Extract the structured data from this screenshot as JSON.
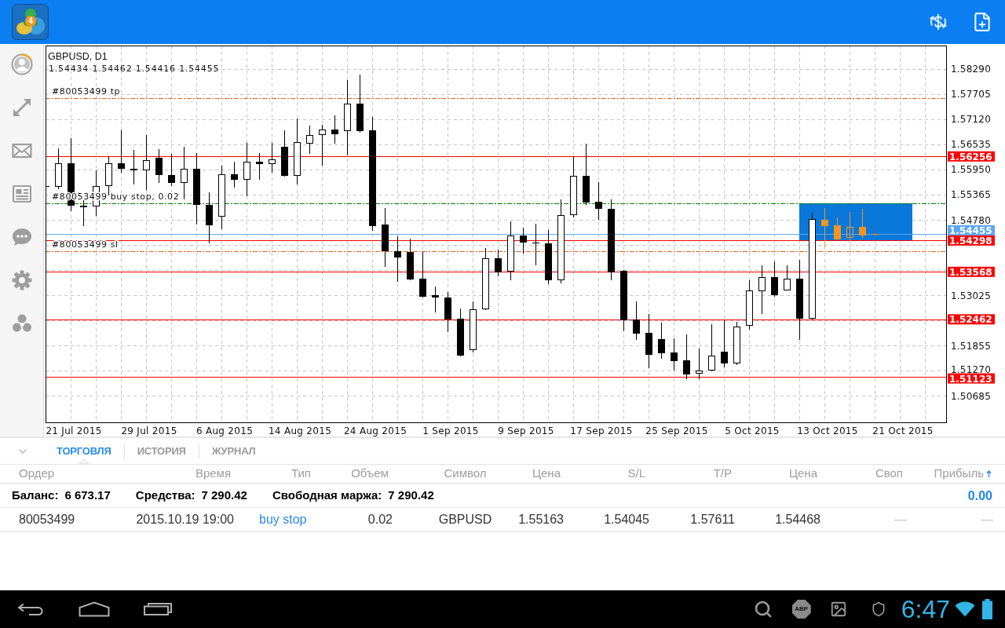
{
  "app_bar": {
    "logo_badge": "4"
  },
  "chart": {
    "chart_data": [
      {
        "type": "candlestick",
        "title": "GBPUSD, D1",
        "subtitle": "1.54434 1.54462 1.54416 1.54455",
        "categories": [
          null,
          null,
          "21 Jul 2015",
          null,
          null,
          null,
          null,
          null,
          "29 Jul 2015",
          null,
          null,
          null,
          null,
          null,
          "6 Aug 2015",
          null,
          null,
          null,
          null,
          null,
          "14 Aug 2015",
          null,
          null,
          null,
          null,
          null,
          "24 Aug 2015",
          null,
          null,
          null,
          null,
          null,
          "1 Sep 2015",
          null,
          null,
          null,
          null,
          null,
          "9 Sep 2015",
          null,
          null,
          null,
          null,
          null,
          "17 Sep 2015",
          null,
          null,
          null,
          null,
          null,
          "25 Sep 2015",
          null,
          null,
          null,
          null,
          null,
          "5 Oct 2015",
          null,
          null,
          null,
          null,
          null,
          "13 Oct 2015",
          null,
          null,
          null,
          null,
          null,
          "21 Oct 2015"
        ],
        "series": [
          {
            "type": "candlestick",
            "color": "#000000",
            "ohlc": [
              [
                1.5556,
                1.5556,
                1.5554,
                1.5554
              ],
              [
                1.5555,
                1.5644,
                1.5549,
                1.561
              ],
              [
                1.561,
                1.5668,
                1.5498,
                1.5511
              ],
              [
                1.5511,
                1.5524,
                1.5463,
                1.5507
              ],
              [
                1.5509,
                1.5593,
                1.5487,
                1.5557
              ],
              [
                1.5557,
                1.5626,
                1.5535,
                1.561
              ],
              [
                1.561,
                1.5686,
                1.5588,
                1.5597
              ],
              [
                1.5597,
                1.5641,
                1.556,
                1.5593
              ],
              [
                1.5593,
                1.5675,
                1.5548,
                1.5617
              ],
              [
                1.5622,
                1.5643,
                1.5564,
                1.5582
              ],
              [
                1.5582,
                1.5632,
                1.5557,
                1.5564
              ],
              [
                1.5564,
                1.5648,
                1.5526,
                1.5597
              ],
              [
                1.5597,
                1.5633,
                1.5467,
                1.5513
              ],
              [
                1.5513,
                1.5542,
                1.5423,
                1.5465
              ],
              [
                1.5485,
                1.5604,
                1.5456,
                1.5584
              ],
              [
                1.5584,
                1.5613,
                1.5553,
                1.5571
              ],
              [
                1.5571,
                1.5657,
                1.5533,
                1.5613
              ],
              [
                1.5613,
                1.5633,
                1.5571,
                1.5608
              ],
              [
                1.5608,
                1.5657,
                1.5588,
                1.5619
              ],
              [
                1.5648,
                1.5686,
                1.5579,
                1.558
              ],
              [
                1.558,
                1.5714,
                1.556,
                1.5659
              ],
              [
                1.5655,
                1.5697,
                1.5632,
                1.5675
              ],
              [
                1.5675,
                1.5699,
                1.5604,
                1.5688
              ],
              [
                1.5688,
                1.5721,
                1.5655,
                1.5677
              ],
              [
                1.5685,
                1.5803,
                1.5628,
                1.5749
              ],
              [
                1.5749,
                1.5816,
                1.5681,
                1.5685
              ],
              [
                1.5686,
                1.5718,
                1.5452,
                1.5463
              ],
              [
                1.5467,
                1.5505,
                1.5368,
                1.5405
              ],
              [
                1.5405,
                1.544,
                1.5334,
                1.539
              ],
              [
                1.5403,
                1.5434,
                1.5337,
                1.5339
              ],
              [
                1.5341,
                1.5405,
                1.5297,
                1.5299
              ],
              [
                1.5303,
                1.5323,
                1.5262,
                1.5297
              ],
              [
                1.5297,
                1.531,
                1.5217,
                1.5246
              ],
              [
                1.5248,
                1.5272,
                1.516,
                1.5162
              ],
              [
                1.5175,
                1.5288,
                1.5169,
                1.527
              ],
              [
                1.527,
                1.5412,
                1.5268,
                1.5389
              ],
              [
                1.5389,
                1.5409,
                1.5346,
                1.5356
              ],
              [
                1.5357,
                1.5474,
                1.5337,
                1.5441
              ],
              [
                1.5441,
                1.546,
                1.5399,
                1.5425
              ],
              [
                1.5425,
                1.5469,
                1.5372,
                1.5423
              ],
              [
                1.5423,
                1.5454,
                1.5328,
                1.5337
              ],
              [
                1.5337,
                1.5526,
                1.533,
                1.5489
              ],
              [
                1.5489,
                1.5626,
                1.5483,
                1.558
              ],
              [
                1.558,
                1.5655,
                1.5513,
                1.5518
              ],
              [
                1.552,
                1.5566,
                1.5478,
                1.5504
              ],
              [
                1.5504,
                1.5526,
                1.5337,
                1.5356
              ],
              [
                1.5359,
                1.5361,
                1.5218,
                1.5244
              ],
              [
                1.5246,
                1.5288,
                1.5198,
                1.5213
              ],
              [
                1.5215,
                1.5259,
                1.5133,
                1.5164
              ],
              [
                1.52,
                1.5239,
                1.5155,
                1.5167
              ],
              [
                1.5169,
                1.5202,
                1.5127,
                1.5149
              ],
              [
                1.5151,
                1.5211,
                1.5107,
                1.5118
              ],
              [
                1.512,
                1.5178,
                1.5107,
                1.5127
              ],
              [
                1.5127,
                1.5235,
                1.5125,
                1.5162
              ],
              [
                1.5171,
                1.5244,
                1.5134,
                1.5144
              ],
              [
                1.5144,
                1.524,
                1.514,
                1.5229
              ],
              [
                1.5231,
                1.5337,
                1.5222,
                1.5314
              ],
              [
                1.5312,
                1.5372,
                1.5259,
                1.5345
              ],
              [
                1.5345,
                1.5381,
                1.5299,
                1.5303
              ],
              [
                1.5314,
                1.5372,
                1.5314,
                1.5341
              ],
              [
                1.5341,
                1.5385,
                1.5198,
                1.5248
              ],
              [
                1.5248,
                1.5495,
                1.5246,
                1.548
              ],
              null,
              null,
              null,
              null,
              null,
              null,
              null
            ]
          },
          {
            "type": "candlestick",
            "color": "#f7941d",
            "ohlc": [
              null,
              null,
              null,
              null,
              null,
              null,
              null,
              null,
              null,
              null,
              null,
              null,
              null,
              null,
              null,
              null,
              null,
              null,
              null,
              null,
              null,
              null,
              null,
              null,
              null,
              null,
              null,
              null,
              null,
              null,
              null,
              null,
              null,
              null,
              null,
              null,
              null,
              null,
              null,
              null,
              null,
              null,
              null,
              null,
              null,
              null,
              null,
              null,
              null,
              null,
              null,
              null,
              null,
              null,
              null,
              null,
              null,
              null,
              null,
              null,
              null,
              null,
              [
                1.5478,
                1.5505,
                1.5414,
                1.5463
              ],
              [
                1.5465,
                1.5483,
                1.5431,
                1.5432
              ],
              [
                1.5436,
                1.5496,
                1.5429,
                1.5462
              ],
              [
                1.5462,
                1.5504,
                1.5434,
                1.5441
              ],
              [
                1.54434,
                1.54462,
                1.54416,
                1.54455
              ],
              null,
              null
            ]
          }
        ],
        "ylim": [
          1.50064,
          1.58838
        ],
        "yticks": [
          {
            "value": 1.5829,
            "label": "1.58290"
          },
          {
            "value": 1.57705,
            "label": "1.57705"
          },
          {
            "value": 1.5712,
            "label": "1.57120"
          },
          {
            "value": 1.56535,
            "label": "1.56535"
          },
          {
            "value": 1.5595,
            "label": "1.55950"
          },
          {
            "value": 1.55365,
            "label": "1.55365"
          },
          {
            "value": 1.5478,
            "label": "1.54780"
          },
          {
            "value": 1.53025,
            "label": "1.53025"
          },
          {
            "value": 1.51855,
            "label": "1.51855"
          },
          {
            "value": 1.5127,
            "label": "1.51270"
          },
          {
            "value": 1.50685,
            "label": "1.50685"
          }
        ],
        "grid": true,
        "ref_lines": [
          {
            "axis": "y",
            "value": 1.57611,
            "label": "#80053499 tp",
            "color": "#ff5a1e",
            "line_style": "dashdot"
          },
          {
            "axis": "y",
            "value": 1.56256,
            "label": "1.56256",
            "color": "#ff0000",
            "line_style": "solid"
          },
          {
            "axis": "y",
            "value": 1.55163,
            "label": "#80053499 buy stop, 0.02",
            "color": "#008000",
            "line_style": "dashdot"
          },
          {
            "axis": "y",
            "value": 1.54455,
            "label": "1.54455",
            "color": "#5aa8f2",
            "line_style": "solid"
          },
          {
            "axis": "y",
            "value": 1.54298,
            "label": "1.54298",
            "color": "#ff0000",
            "line_style": "solid"
          },
          {
            "axis": "y",
            "value": 1.54045,
            "label": "#80053499 sl",
            "color": "#ff5a1e",
            "line_style": "dashdot"
          },
          {
            "axis": "y",
            "value": 1.53568,
            "label": "1.53568",
            "color": "#ff0000",
            "line_style": "solid"
          },
          {
            "axis": "y",
            "value": 1.52462,
            "label": "1.52462",
            "color": "#ff0000",
            "line_style": "solid"
          },
          {
            "axis": "y",
            "value": 1.51123,
            "label": "1.51123",
            "color": "#ff0000",
            "line_style": "solid"
          }
        ]
      }
    ],
    "objects": [
      {
        "kind": "rectangle"
      }
    ]
  },
  "terminal": {
    "tabs": [
      {
        "label": "ТОРГОВЛЯ",
        "selected": true
      },
      {
        "label": "ИСТОРИЯ",
        "selected": false
      },
      {
        "label": "ЖУРНАЛ",
        "selected": false
      }
    ],
    "columns": [
      {
        "label": "Ордер",
        "sorted": false
      },
      {
        "label": "Время",
        "sorted": false
      },
      {
        "label": "Тип",
        "sorted": false
      },
      {
        "label": "Объем",
        "sorted": false
      },
      {
        "label": "Символ",
        "sorted": false
      },
      {
        "label": "Цена",
        "sorted": false
      },
      {
        "label": "S/L",
        "sorted": false
      },
      {
        "label": "T/P",
        "sorted": false
      },
      {
        "label": "Цена",
        "sorted": false
      },
      {
        "label": "Своп",
        "sorted": false
      },
      {
        "label": "Прибыль",
        "sorted": true
      }
    ],
    "summary": {
      "items": [
        {
          "label": "Баланс:",
          "value": "6 673.17"
        },
        {
          "label": "Средства:",
          "value": "7 290.42"
        },
        {
          "label": "Свободная маржа:",
          "value": "7 290.42"
        }
      ],
      "profit": "0.00"
    },
    "rows": [
      {
        "cells": [
          "80053499",
          "2015.10.19 19:00",
          "buy stop",
          "0.02",
          "GBPUSD",
          "1.55163",
          "1.54045",
          "1.57611",
          "1.54468",
          "—",
          "—"
        ],
        "color": "#2a8ae6"
      }
    ]
  },
  "system_bar": {
    "adblock_label": "ABP",
    "time": "6:47"
  }
}
